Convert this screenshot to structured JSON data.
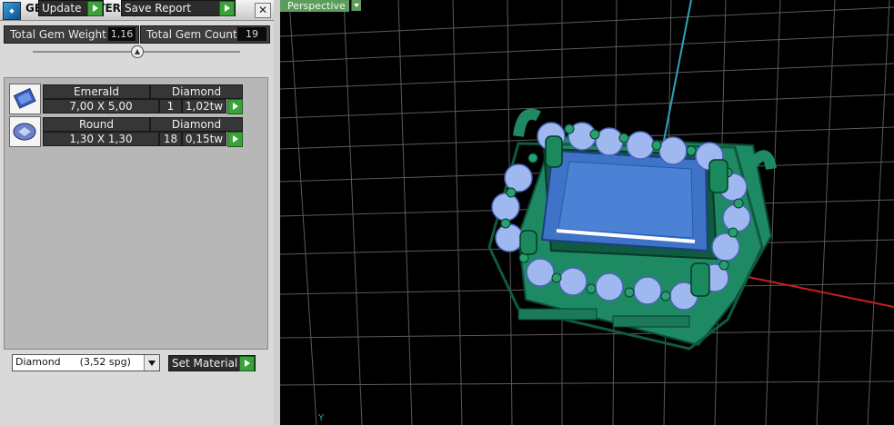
{
  "panel": {
    "title": "GEM REPORTER",
    "icon": "gem-reporter-icon",
    "close_glyph": "✕",
    "total_weight_label": "Total Gem Weight",
    "total_weight_value": "1,16",
    "total_count_label": "Total Gem Count",
    "total_count_value": "19",
    "update_label": "Update",
    "save_report_label": "Save Report",
    "gems": [
      {
        "cut": "Emerald",
        "material": "Diamond",
        "size": "7,00 X 5,00",
        "count": "1",
        "weight": "1,02tw",
        "icon": "emerald-cut-gem-icon"
      },
      {
        "cut": "Round",
        "material": "Diamond",
        "size": "1,30 X 1,30",
        "count": "18",
        "weight": "0,15tw",
        "icon": "round-cut-gem-icon"
      }
    ],
    "material_select": "Diamond      (3,52 spg)",
    "set_material_label": "Set Material"
  },
  "viewport": {
    "view_label": "Perspective",
    "axis_label": "Y"
  },
  "colors": {
    "accent_green": "#3aa23a",
    "viewport_label_bg": "#5e9b5e",
    "metal": "#1e8a64",
    "center_stone": "#3f73c8",
    "side_stones": "#9fb8f0"
  }
}
